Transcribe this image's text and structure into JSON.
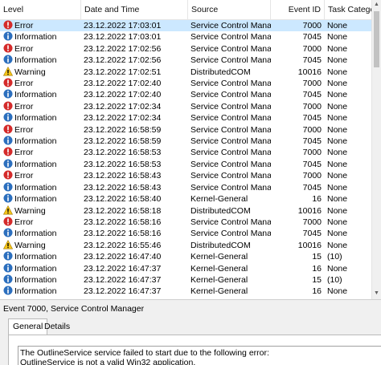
{
  "columns": {
    "level": "Level",
    "date": "Date and Time",
    "source": "Source",
    "event_id": "Event ID",
    "task_category": "Task Category"
  },
  "icons": {
    "Error": "error-icon",
    "Information": "information-icon",
    "Warning": "warning-icon"
  },
  "colors": {
    "selected_row": "#cce8ff",
    "error": "#d42b2b",
    "information": "#2c6fbe",
    "warning": "#f5c518"
  },
  "events": [
    {
      "level": "Error",
      "date": "23.12.2022 17:03:01",
      "source": "Service Control Mana...",
      "event_id": "7000",
      "category": "None",
      "selected": true
    },
    {
      "level": "Information",
      "date": "23.12.2022 17:03:01",
      "source": "Service Control Mana...",
      "event_id": "7045",
      "category": "None"
    },
    {
      "level": "Error",
      "date": "23.12.2022 17:02:56",
      "source": "Service Control Mana...",
      "event_id": "7000",
      "category": "None"
    },
    {
      "level": "Information",
      "date": "23.12.2022 17:02:56",
      "source": "Service Control Mana...",
      "event_id": "7045",
      "category": "None"
    },
    {
      "level": "Warning",
      "date": "23.12.2022 17:02:51",
      "source": "DistributedCOM",
      "event_id": "10016",
      "category": "None"
    },
    {
      "level": "Error",
      "date": "23.12.2022 17:02:40",
      "source": "Service Control Mana...",
      "event_id": "7000",
      "category": "None"
    },
    {
      "level": "Information",
      "date": "23.12.2022 17:02:40",
      "source": "Service Control Mana...",
      "event_id": "7045",
      "category": "None"
    },
    {
      "level": "Error",
      "date": "23.12.2022 17:02:34",
      "source": "Service Control Mana...",
      "event_id": "7000",
      "category": "None"
    },
    {
      "level": "Information",
      "date": "23.12.2022 17:02:34",
      "source": "Service Control Mana...",
      "event_id": "7045",
      "category": "None"
    },
    {
      "level": "Error",
      "date": "23.12.2022 16:58:59",
      "source": "Service Control Mana...",
      "event_id": "7000",
      "category": "None"
    },
    {
      "level": "Information",
      "date": "23.12.2022 16:58:59",
      "source": "Service Control Mana...",
      "event_id": "7045",
      "category": "None"
    },
    {
      "level": "Error",
      "date": "23.12.2022 16:58:53",
      "source": "Service Control Mana...",
      "event_id": "7000",
      "category": "None"
    },
    {
      "level": "Information",
      "date": "23.12.2022 16:58:53",
      "source": "Service Control Mana...",
      "event_id": "7045",
      "category": "None"
    },
    {
      "level": "Error",
      "date": "23.12.2022 16:58:43",
      "source": "Service Control Mana...",
      "event_id": "7000",
      "category": "None"
    },
    {
      "level": "Information",
      "date": "23.12.2022 16:58:43",
      "source": "Service Control Mana...",
      "event_id": "7045",
      "category": "None"
    },
    {
      "level": "Information",
      "date": "23.12.2022 16:58:40",
      "source": "Kernel-General",
      "event_id": "16",
      "category": "None"
    },
    {
      "level": "Warning",
      "date": "23.12.2022 16:58:18",
      "source": "DistributedCOM",
      "event_id": "10016",
      "category": "None"
    },
    {
      "level": "Error",
      "date": "23.12.2022 16:58:16",
      "source": "Service Control Mana...",
      "event_id": "7000",
      "category": "None"
    },
    {
      "level": "Information",
      "date": "23.12.2022 16:58:16",
      "source": "Service Control Mana...",
      "event_id": "7045",
      "category": "None"
    },
    {
      "level": "Warning",
      "date": "23.12.2022 16:55:46",
      "source": "DistributedCOM",
      "event_id": "10016",
      "category": "None"
    },
    {
      "level": "Information",
      "date": "23.12.2022 16:47:40",
      "source": "Kernel-General",
      "event_id": "15",
      "category": "(10)"
    },
    {
      "level": "Information",
      "date": "23.12.2022 16:47:37",
      "source": "Kernel-General",
      "event_id": "16",
      "category": "None"
    },
    {
      "level": "Information",
      "date": "23.12.2022 16:47:37",
      "source": "Kernel-General",
      "event_id": "15",
      "category": "(10)"
    },
    {
      "level": "Information",
      "date": "23.12.2022 16:47:37",
      "source": "Kernel-General",
      "event_id": "16",
      "category": "None"
    }
  ],
  "detail": {
    "title": "Event 7000, Service Control Manager",
    "tabs": [
      "General",
      "Details"
    ],
    "message_line1": "The OutlineService service failed to start due to the following error:",
    "message_line2": "OutlineService is not a valid Win32 application."
  }
}
